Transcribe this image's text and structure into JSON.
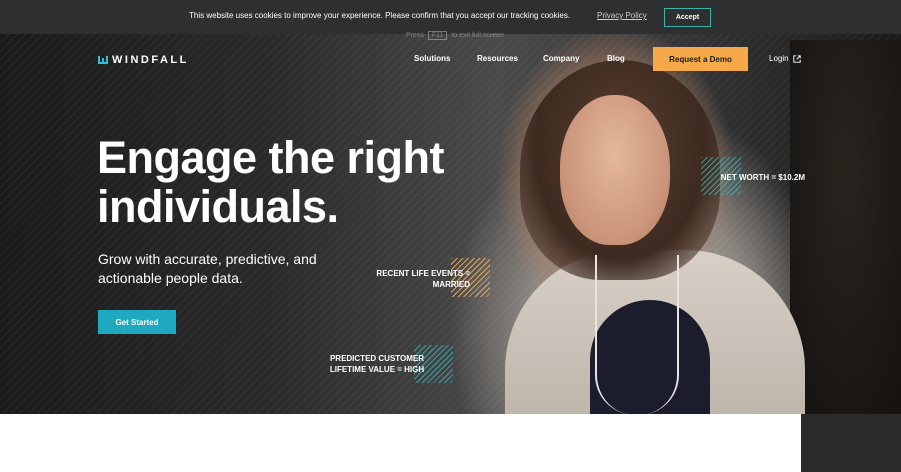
{
  "cookie_banner": {
    "text": "This website uses cookies to improve your experience. Please confirm that you accept our tracking cookies.",
    "privacy_link": "Privacy Policy",
    "accept_label": "Accept"
  },
  "fullscreen_hint": {
    "before": "Press",
    "key": "F11",
    "after": "to exit full screen"
  },
  "header": {
    "logo_text": "WINDFALL",
    "nav": [
      "Solutions",
      "Resources",
      "Company",
      "Blog"
    ],
    "demo_label": "Request a Demo",
    "login_label": "Login"
  },
  "hero": {
    "headline_line1": "Engage the right",
    "headline_line2": "individuals.",
    "subhead_line1": "Grow with accurate, predictive, and",
    "subhead_line2": "actionable people data.",
    "cta_label": "Get Started"
  },
  "data_tags": {
    "net_worth": "NET WORTH = $10.2M",
    "life_events_line1": "RECENT LIFE EVENTS =",
    "life_events_line2": "MARRIED",
    "clv_line1": "PREDICTED CUSTOMER",
    "clv_line2": "LIFETIME VALUE = HIGH"
  },
  "colors": {
    "accent_teal": "#1fa9c0",
    "accent_orange": "#f5a94b",
    "banner_bg": "#2e2f30"
  }
}
